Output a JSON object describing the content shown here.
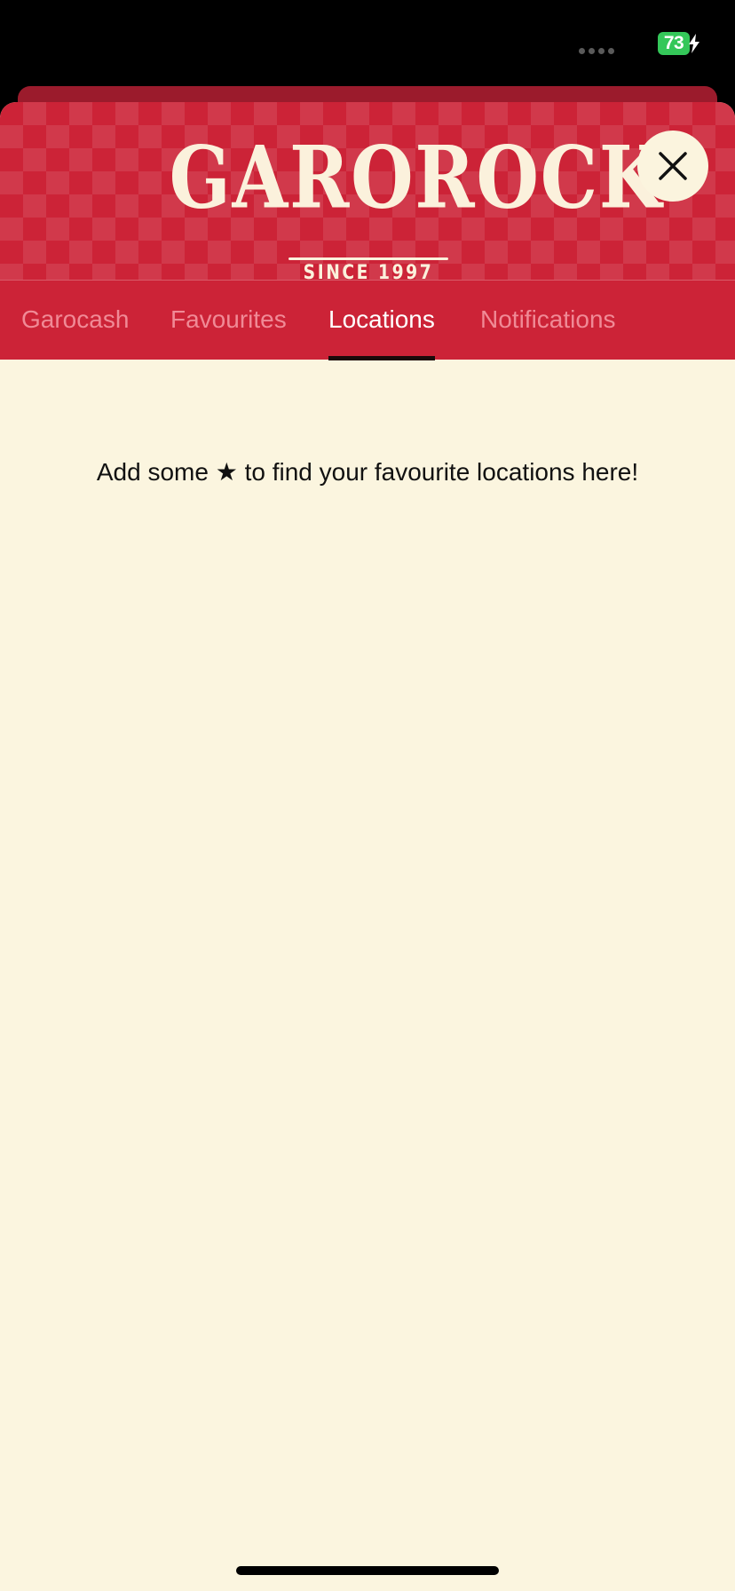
{
  "status_bar": {
    "battery_level": "73",
    "icons": [
      "signal-dots-icon",
      "charging-bolt-icon"
    ]
  },
  "header": {
    "logo_text": "GAROROCK",
    "logo_subtitle": "SINCE 1997",
    "close_icon": "close-icon"
  },
  "tabs": [
    {
      "label": "Garocash",
      "active": false
    },
    {
      "label": "Favourites",
      "active": false
    },
    {
      "label": "Locations",
      "active": true
    },
    {
      "label": "Notifications",
      "active": false
    }
  ],
  "content": {
    "empty_message": "Add some ★ to find your favourite locations here!"
  },
  "colors": {
    "brand_red": "#cc2337",
    "cream": "#fbf5df",
    "battery_green": "#34c759"
  }
}
